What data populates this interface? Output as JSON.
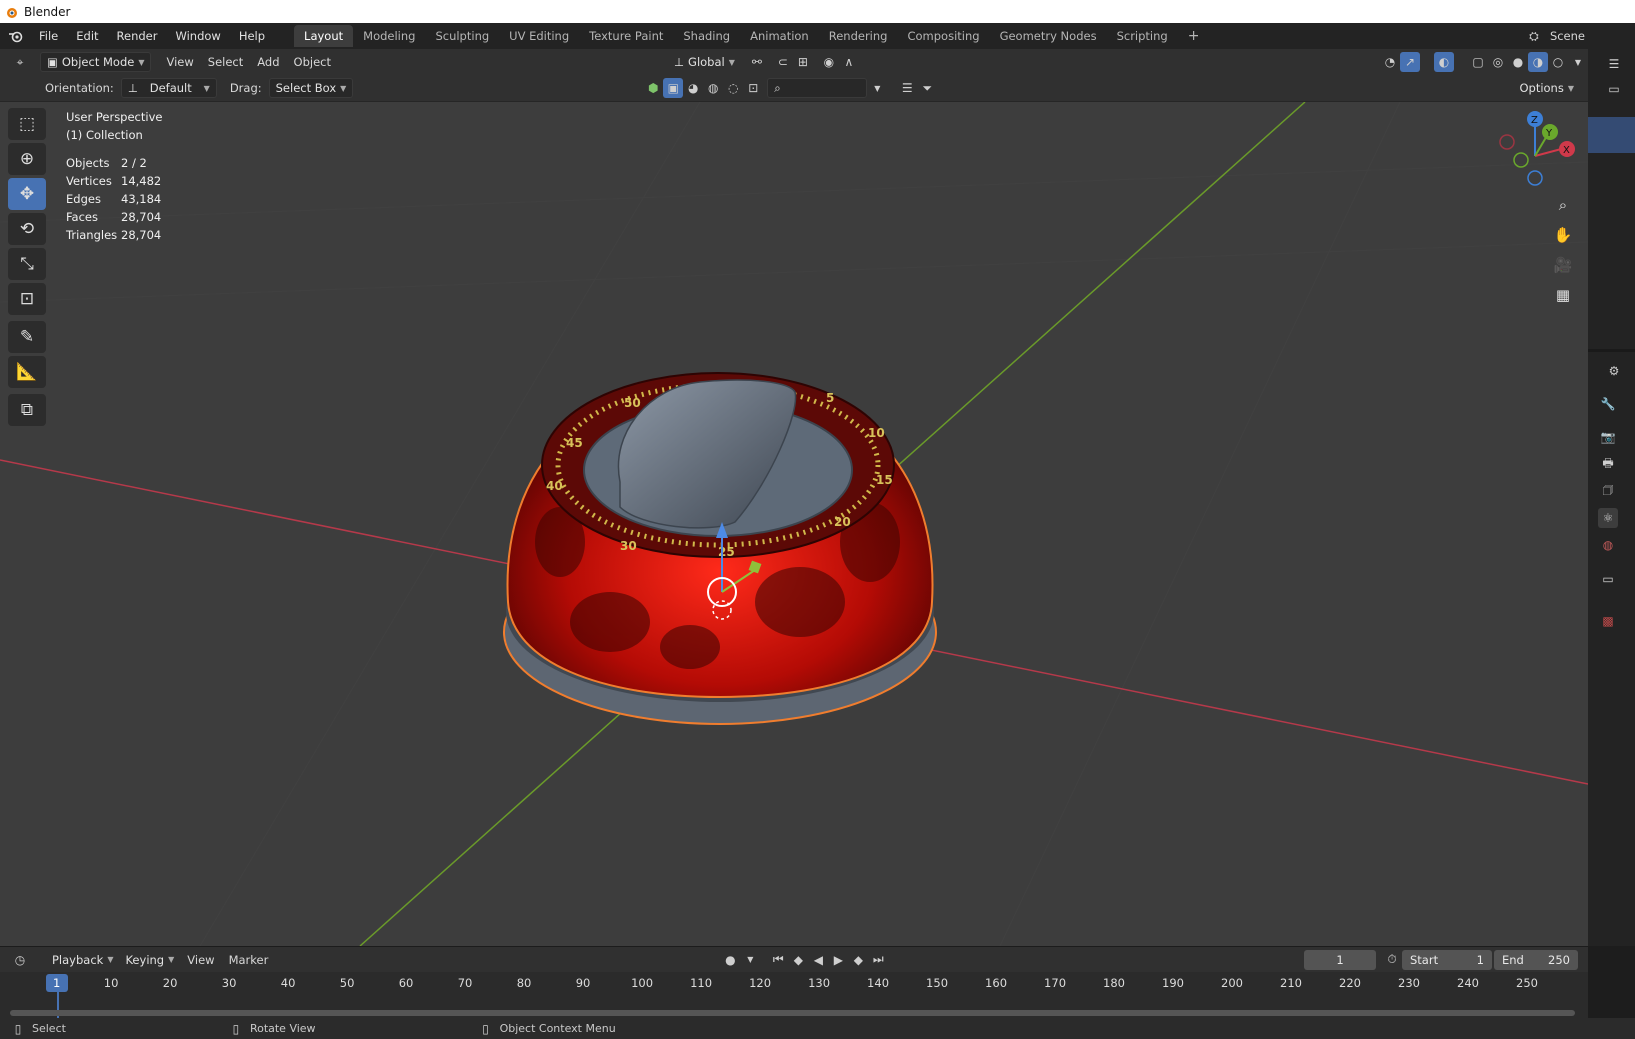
{
  "window": {
    "title": "Blender"
  },
  "menu": [
    "File",
    "Edit",
    "Render",
    "Window",
    "Help"
  ],
  "workspaces": [
    "Layout",
    "Modeling",
    "Sculpting",
    "UV Editing",
    "Texture Paint",
    "Shading",
    "Animation",
    "Rendering",
    "Compositing",
    "Geometry Nodes",
    "Scripting"
  ],
  "active_workspace": "Layout",
  "scene_name": "Scene",
  "viewport_header": {
    "mode": "Object Mode",
    "menus": [
      "View",
      "Select",
      "Add",
      "Object"
    ],
    "transform_orientation": "Global",
    "options_label": "Options"
  },
  "tool_settings": {
    "orientation_label": "Orientation:",
    "orientation_value": "Default",
    "drag_label": "Drag:",
    "drag_value": "Select Box"
  },
  "overlay_text": {
    "perspective": "User Perspective",
    "collection": "(1) Collection",
    "stats": [
      {
        "label": "Objects",
        "value": "2 / 2"
      },
      {
        "label": "Vertices",
        "value": "14,482"
      },
      {
        "label": "Edges",
        "value": "43,184"
      },
      {
        "label": "Faces",
        "value": "28,704"
      },
      {
        "label": "Triangles",
        "value": "28,704"
      }
    ]
  },
  "dial_numbers": [
    "5",
    "10",
    "15",
    "20",
    "25",
    "30",
    "40",
    "45",
    "50"
  ],
  "gizmo_axes": {
    "x": "X",
    "y": "Y",
    "z": "Z"
  },
  "timeline": {
    "menus": [
      "Playback",
      "Keying",
      "View",
      "Marker"
    ],
    "current_frame": "1",
    "start_label": "Start",
    "start": "1",
    "end_label": "End",
    "end": "250",
    "ticks": [
      "1",
      "10",
      "20",
      "30",
      "40",
      "50",
      "60",
      "70",
      "80",
      "90",
      "100",
      "110",
      "120",
      "130",
      "140",
      "150",
      "160",
      "170",
      "180",
      "190",
      "200",
      "210",
      "220",
      "230",
      "240",
      "250"
    ]
  },
  "status_bar": {
    "left": "Select",
    "middle": "Rotate View",
    "right": "Object Context Menu"
  }
}
